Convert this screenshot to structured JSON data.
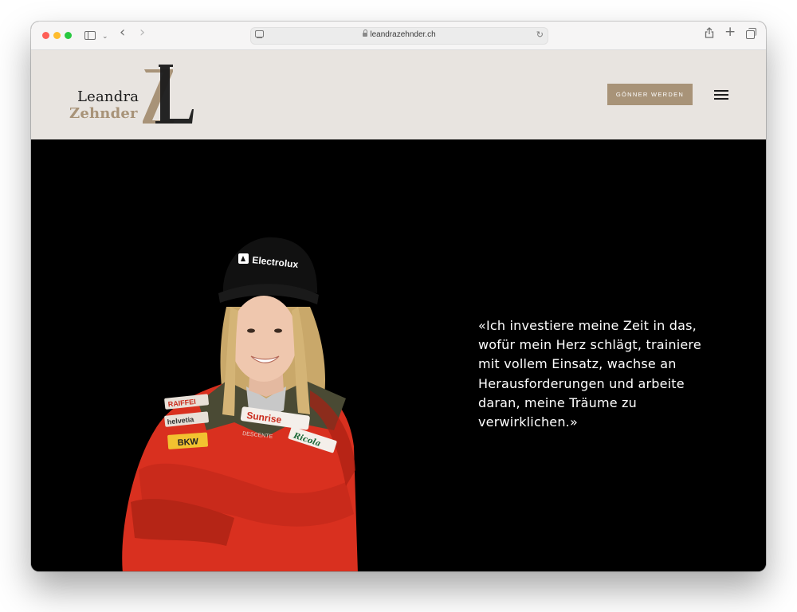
{
  "browser": {
    "url": "leandrazehnder.ch"
  },
  "header": {
    "logo_first_name": "Leandra",
    "logo_last_name": "Zehnder",
    "logo_monogram": "ZL",
    "cta_label": "GÖNNER WERDEN",
    "accent_color": "#a89378",
    "background_color": "#e8e4e0"
  },
  "hero": {
    "quote": "«Ich investiere meine Zeit in das, wofür mein Herz schlägt, trainiere mit vollem Einsatz, wachse an Herausforderungen und arbeite daran, meine Träume zu verwirklichen.»",
    "photo_logos": [
      "Electrolux",
      "RAIFFEI",
      "helvetia",
      "BKW",
      "Sunrise",
      "Ricola",
      "DESCENTE"
    ],
    "background_color": "#000000"
  }
}
